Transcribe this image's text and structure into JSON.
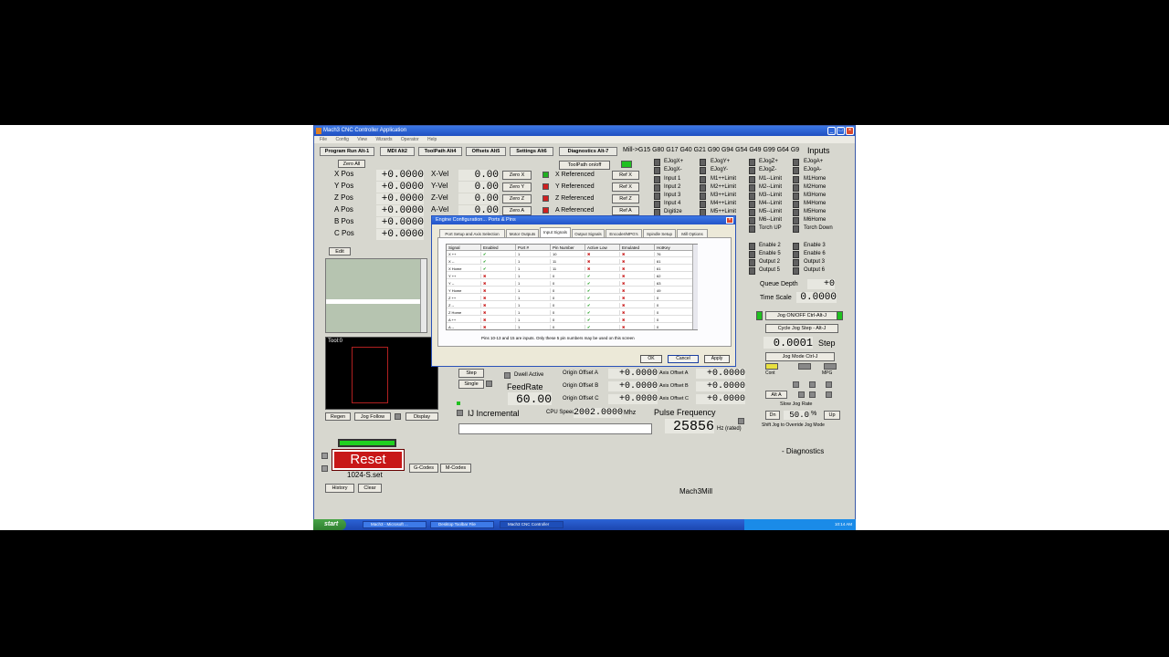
{
  "window": {
    "title": "Mach3 CNC Controller Application",
    "menu": [
      "File",
      "Config",
      "View",
      "Wizards",
      "Operator",
      "Help"
    ]
  },
  "tabs": [
    "Program Run Alt-1",
    "MDI Alt2",
    "ToolPath Alt4",
    "Offsets Alt5",
    "Settings Alt6",
    "Diagnostics Alt-7"
  ],
  "status_line": "Mill->G15  G80 G17 G40 G21 G90 G94 G54 G49 G99 G64 G9",
  "inputs_title": "Inputs",
  "axes": [
    {
      "label": "X Pos",
      "value": "+0.0000",
      "vel_label": "X-Vel",
      "vel": "0.00",
      "zero": "Zero X",
      "ref": "X Referenced",
      "ref_btn": "Ref X",
      "ref_color": "#20b020"
    },
    {
      "label": "Y Pos",
      "value": "+0.0000",
      "vel_label": "Y-Vel",
      "vel": "0.00",
      "zero": "Zero Y",
      "ref": "Y Referenced",
      "ref_btn": "Ref X",
      "ref_color": "#d02020"
    },
    {
      "label": "Z Pos",
      "value": "+0.0000",
      "vel_label": "Z-Vel",
      "vel": "0.00",
      "zero": "Zero Z",
      "ref": "Z Referenced",
      "ref_btn": "Ref Z",
      "ref_color": "#d02020"
    },
    {
      "label": "A Pos",
      "value": "+0.0000",
      "vel_label": "A-Vel",
      "vel": "0.00",
      "zero": "Zero A",
      "ref": "A Referenced",
      "ref_btn": "Ref A",
      "ref_color": "#d02020"
    },
    {
      "label": "B Pos",
      "value": "+0.0000"
    },
    {
      "label": "C Pos",
      "value": "+0.0000"
    }
  ],
  "buttons": {
    "zero_all": "Zero All",
    "toolpath_on_off": "ToolPath on/off",
    "edit": "Edit",
    "regen": "Regen",
    "jog_follow": "Jog Follow",
    "display": "Display",
    "step": "Step",
    "single": "Single",
    "reset": "Reset",
    "g_codes": "G-Codes",
    "m_codes": "M-Codes",
    "history": "History",
    "clear": "Clear",
    "jog_on_off": "Jog ON/OFF Ctrl-Alt-J",
    "cycle_jog_step": "Cycle Jog Step - Alt-J",
    "jog_mode": "Jog Mode Ctrl-J",
    "alt_a": "Alt A",
    "slow_minus": "Dn",
    "slow_plus": "Up"
  },
  "tool_label": "Tool:0",
  "profile": "1024-S.set",
  "inputs_col1": [
    "EJogX+",
    "EJogX-",
    "Input 1",
    "Input 2",
    "Input 3",
    "Input 4",
    "Digitize"
  ],
  "inputs_col2": [
    "EJogY+",
    "EJogY-",
    "M1++Limit",
    "M2++Limit",
    "M3++Limit",
    "M4++Limit",
    "M5++Limit"
  ],
  "inputs_col3": [
    "EJogZ+",
    "EJogZ-",
    "M1--Limit",
    "M2--Limit",
    "M3--Limit",
    "M4--Limit",
    "M5--Limit",
    "M6--Limit",
    "Torch UP"
  ],
  "inputs_col4": [
    "EJogA+",
    "EJogA-",
    "M1Home",
    "M2Home",
    "M3Home",
    "M4Home",
    "M5Home",
    "M6Home",
    "Torch Down"
  ],
  "outputs_col1": [
    "Enable 2",
    "Enable 5",
    "Output 2",
    "Output 5"
  ],
  "outputs_col2": [
    "Enable 3",
    "Enable 6",
    "Output 3",
    "Output 6"
  ],
  "queue_depth_label": "Queue Depth",
  "queue_depth": "+0",
  "time_scale_label": "Time Scale",
  "time_scale": "0.0000",
  "step_value": "0.0001",
  "step_label": "Step",
  "jog_labels": [
    "Cont",
    "MPG"
  ],
  "slow_jog_label": "Slow Jog Rate",
  "slow_jog_value": "50.0",
  "slow_jog_unit": "%",
  "shift_label": "Shift Jog to Override Jog Mode",
  "diagnostics": "- Diagnostics",
  "app_name": "Mach3Mill",
  "feedrate_label": "FeedRate",
  "feedrate": "60.00",
  "dwell_label": "Dwell Active",
  "ij_label": "IJ Incremental",
  "cpu_label": "CPU Speed",
  "cpu_value": "2002.0000",
  "cpu_unit": "Mhz",
  "pulse_label": "Pulse Frequency",
  "pulse_value": "25856",
  "pulse_unit": "Hz (rated)",
  "offsets": [
    {
      "label": "Origin Offset A",
      "value": "+0.0000",
      "axis_label": "Axis Offset A",
      "axis_value": "+0.0000"
    },
    {
      "label": "Origin Offset B",
      "value": "+0.0000",
      "axis_label": "Axis Offset B",
      "axis_value": "+0.0000"
    },
    {
      "label": "Origin Offset C",
      "value": "+0.0000",
      "axis_label": "Axis Offset C",
      "axis_value": "+0.0000"
    }
  ],
  "dialog": {
    "title": "Engine Configuration... Ports & Pins",
    "tabs": [
      "Port Setup and Axis Selection",
      "Motor Outputs",
      "Input Signals",
      "Output Signals",
      "Encoder/MPG's",
      "Spindle Setup",
      "Mill Options"
    ],
    "columns": [
      "Signal",
      "Enabled",
      "Port #",
      "Pin Number",
      "Active Low",
      "Emulated",
      "HotKey"
    ],
    "rows": [
      [
        "X ++",
        "ok",
        "1",
        "10",
        "no",
        "no",
        "76"
      ],
      [
        "X --",
        "ok",
        "1",
        "11",
        "no",
        "no",
        "61"
      ],
      [
        "X Home",
        "ok",
        "1",
        "11",
        "no",
        "no",
        "61"
      ],
      [
        "Y ++",
        "no",
        "1",
        "0",
        "ok",
        "no",
        "62"
      ],
      [
        "Y --",
        "no",
        "1",
        "0",
        "ok",
        "no",
        "63"
      ],
      [
        "Y Home",
        "no",
        "1",
        "0",
        "ok",
        "no",
        "49"
      ],
      [
        "Z ++",
        "no",
        "1",
        "0",
        "ok",
        "no",
        "0"
      ],
      [
        "Z --",
        "no",
        "1",
        "0",
        "ok",
        "no",
        "0"
      ],
      [
        "Z Home",
        "no",
        "1",
        "0",
        "ok",
        "no",
        "0"
      ],
      [
        "A ++",
        "no",
        "1",
        "0",
        "ok",
        "no",
        "0"
      ],
      [
        "A --",
        "no",
        "1",
        "0",
        "ok",
        "no",
        "0"
      ]
    ],
    "note": "Pins 10-13 and 15 are inputs. Only these 5 pin numbers may be used on this screen",
    "ok": "OK",
    "cancel": "Cancel",
    "apply": "Apply"
  },
  "taskbar": {
    "start": "start",
    "tasks": [
      "Mach3 - Microsoft ...",
      "Desktop Toolbar File",
      "Mach3 CNC Controller"
    ],
    "clock": "10:14 AM"
  }
}
